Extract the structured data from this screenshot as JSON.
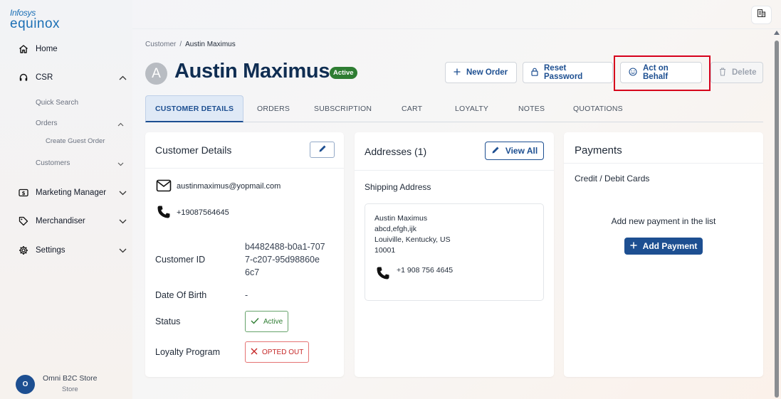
{
  "logo": {
    "line1": "Infosys",
    "line2": "equinox"
  },
  "sidebar": {
    "home": "Home",
    "csr": "CSR",
    "quick_search": "Quick Search",
    "orders": "Orders",
    "create_guest_order": "Create Guest Order",
    "customers": "Customers",
    "marketing_manager": "Marketing Manager",
    "merchandiser": "Merchandiser",
    "settings": "Settings"
  },
  "store": {
    "initial": "O",
    "name": "Omni B2C Store",
    "subtitle": "Store"
  },
  "breadcrumb": {
    "parent": "Customer",
    "separator": "/",
    "current": "Austin Maximus"
  },
  "customer": {
    "initial": "A",
    "name": "Austin Maximus",
    "status_badge": "Active"
  },
  "actions": {
    "new_order": "New Order",
    "reset_password": "Reset Password",
    "act_on_behalf": "Act on Behalf",
    "delete": "Delete"
  },
  "tabs": [
    "CUSTOMER DETAILS",
    "ORDERS",
    "SUBSCRIPTION",
    "CART",
    "LOYALTY",
    "NOTES",
    "QUOTATIONS"
  ],
  "details": {
    "title": "Customer Details",
    "email": "austinmaximus@yopmail.com",
    "phone": "+19087564645",
    "id_label": "Customer ID",
    "id_line1": "b4482488-b0a1-707",
    "id_line2": "7-c207-95d98860e",
    "id_line3": "6c7",
    "dob_label": "Date Of Birth",
    "dob_value": "-",
    "status_label": "Status",
    "status_value": "Active",
    "loyalty_label": "Loyalty Program",
    "loyalty_value": "OPTED OUT"
  },
  "addresses": {
    "title": "Addresses (1)",
    "view_all": "View All",
    "shipping_label": "Shipping Address",
    "name": "Austin Maximus",
    "line1": "abcd,efgh,ijk",
    "line2": "Louiville, Kentucky, US",
    "zip": "10001",
    "phone": "+1 908 756 4645"
  },
  "payments": {
    "title": "Payments",
    "cards_label": "Credit / Debit Cards",
    "empty_text": "Add new payment in the list",
    "add_button": "Add Payment"
  },
  "colors": {
    "brand": "#1d4f91",
    "active_green": "#2e7d32",
    "opted_out_red": "#c62828",
    "highlight_red": "#d6001c"
  }
}
